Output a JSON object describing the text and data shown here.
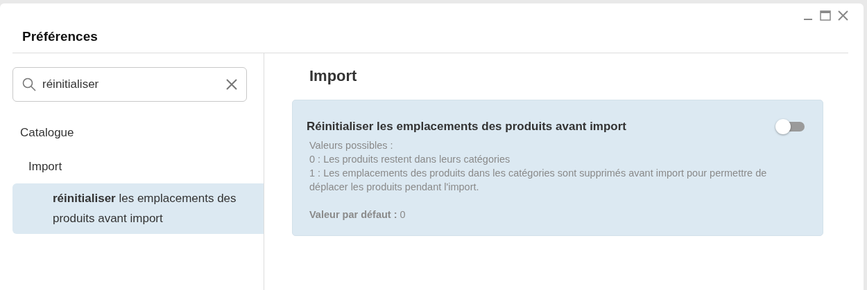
{
  "window": {
    "title": "Préférences"
  },
  "search": {
    "value": "réinitialiser"
  },
  "tree": [
    {
      "label": "Catalogue",
      "selected": false,
      "children": [
        {
          "label": "Import",
          "selected": false,
          "children": [
            {
              "label": "**réinitialiser** les emplacements des produits avant import",
              "selected": true
            }
          ]
        }
      ]
    }
  ],
  "section": {
    "title": "Import"
  },
  "setting": {
    "title": "Réinitialiser les emplacements des produits avant import",
    "on": false,
    "description": [
      "Valeurs possibles :",
      "0 : Les produits restent dans leurs catégories",
      "1 : Les emplacements des produits dans les catégories sont supprimés avant import pour permettre de déplacer les produits pendant l'import."
    ],
    "default": "**Valeur par défaut :** 0"
  }
}
